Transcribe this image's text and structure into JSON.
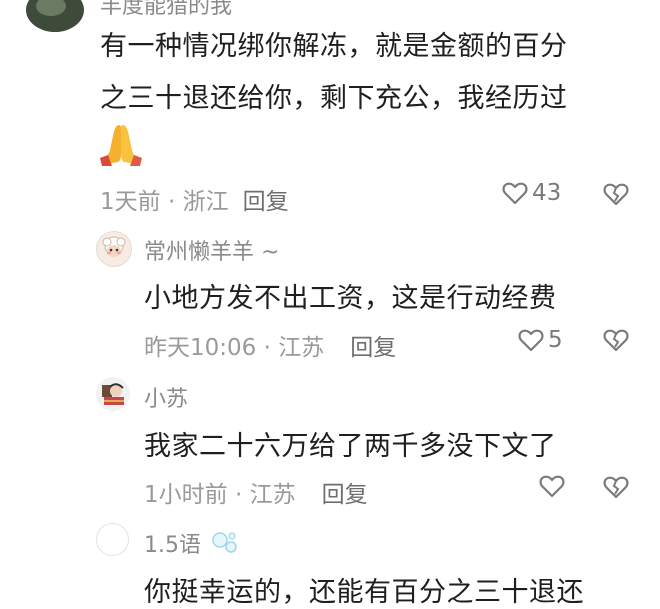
{
  "comment1": {
    "name": "丰度能猎的我",
    "line1": "有一种情况绑你解冻，就是金额的百分",
    "line2": "之三十退还给你，剩下充公，我经历过",
    "emoji_icon": "folded-hands-icon",
    "meta": "1天前 · 浙江",
    "reply_label": "回复",
    "likes": "43"
  },
  "reply1": {
    "name": "常州懒羊羊 ~",
    "text": "小地方发不出工资，这是行动经费",
    "meta": "昨天10:06 · 江苏",
    "reply_label": "回复",
    "likes": "5"
  },
  "reply2": {
    "name": "小苏",
    "text": "我家二十六万给了两千多没下文了",
    "meta": "1小时前 · 江苏",
    "reply_label": "回复",
    "likes": ""
  },
  "reply3": {
    "name": "1.5语",
    "text": "你挺幸运的，还能有百分之三十退还"
  },
  "colors": {
    "text": "#1f1f1f",
    "meta": "#9a9a9a",
    "icon": "#7a7a7a"
  }
}
